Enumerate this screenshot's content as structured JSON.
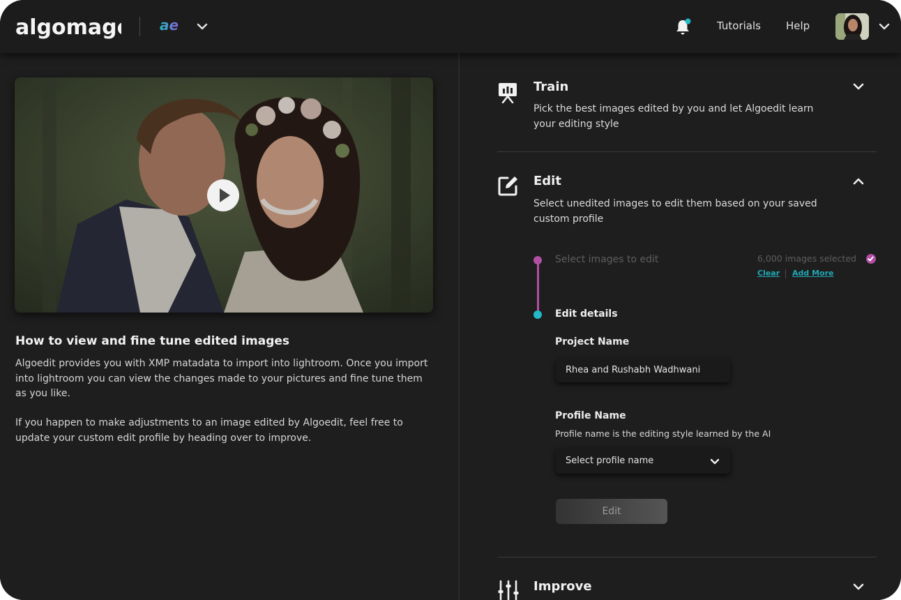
{
  "header": {
    "logo_text": "algomage",
    "product_logo": "ae",
    "nav_tutorials": "Tutorials",
    "nav_help": "Help",
    "notification_dot_color": "#23b9c7"
  },
  "left": {
    "video_title": "How to view and fine tune edited images",
    "paragraph_1": "Algoedit provides you with XMP matadata to import into lightroom. Once you import into lightroom you can view the changes made to your pictures and fine tune them as you like.",
    "paragraph_2": "If you happen to make adjustments to an image edited by Algoedit, feel free to update your custom edit profile by heading over to improve."
  },
  "sections": {
    "train": {
      "title": "Train",
      "description": "Pick the best images edited by you and let Algoedit learn your editing style",
      "icon": "presentation-board-icon",
      "expanded": false
    },
    "edit": {
      "title": "Edit",
      "description": "Select unedited images to edit them based on your saved custom profile",
      "icon": "edit-icon",
      "expanded": true,
      "step1_label": "Select images to edit",
      "selected_count": "6,000 images selected",
      "clear_label": "Clear",
      "add_more_label": "Add More",
      "step2_label": "Edit details",
      "project_name_label": "Project Name",
      "project_name_value": "Rhea and Rushabh Wadhwani",
      "profile_name_label": "Profile Name",
      "profile_name_help": "Profile name is the editing style learned by the AI",
      "profile_select_value": "Select profile name",
      "edit_button_label": "Edit"
    },
    "improve": {
      "title": "Improve",
      "icon": "sliders-icon",
      "expanded": false
    }
  },
  "colors": {
    "accent_pink": "#b24fa2",
    "accent_teal": "#23b9c7",
    "background": "#1e1e1e"
  }
}
